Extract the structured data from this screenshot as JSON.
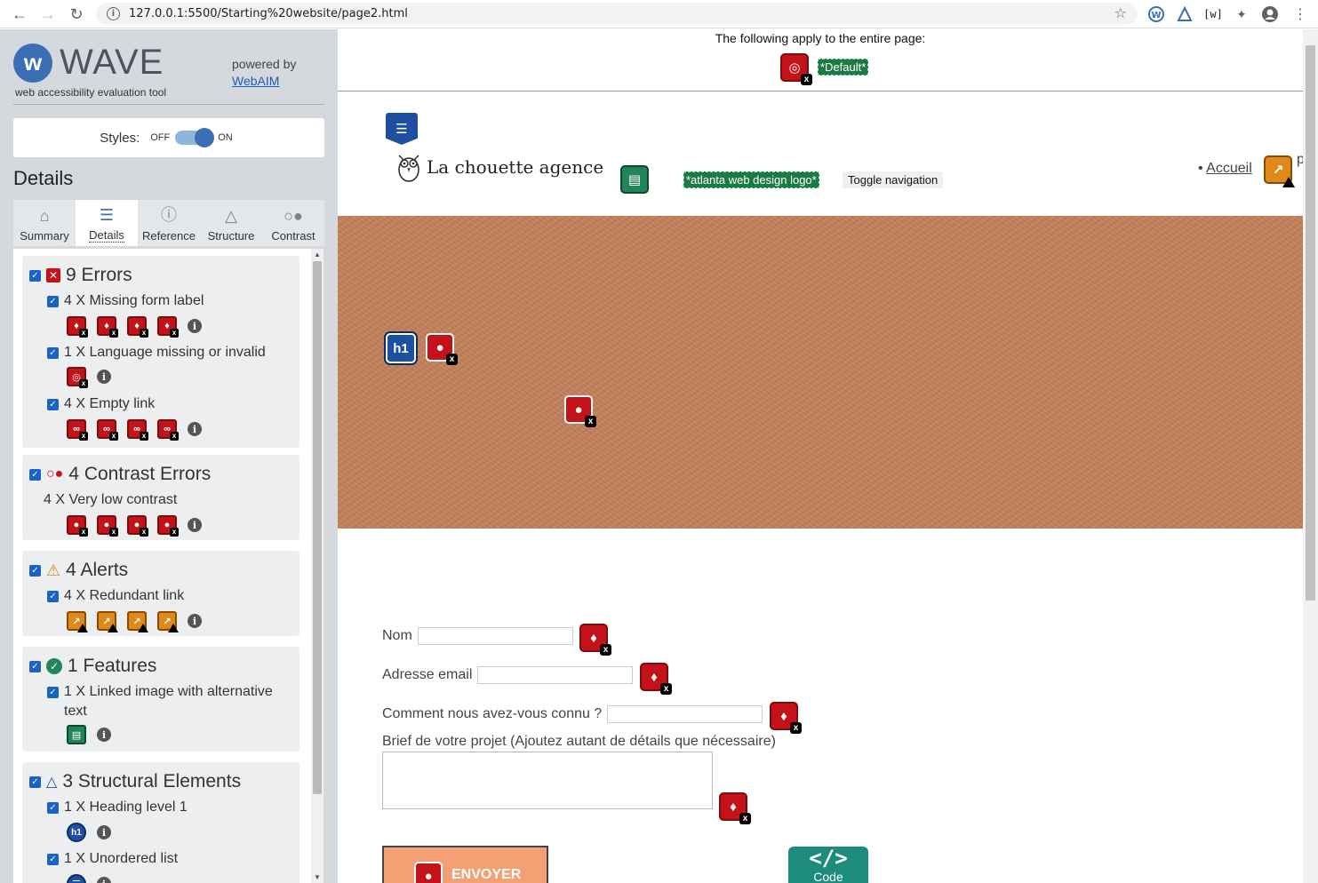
{
  "browser": {
    "url": "127.0.0.1:5500/Starting%20website/page2.html"
  },
  "wave": {
    "logo_text": "WAVE",
    "subtitle": "web accessibility evaluation tool",
    "powered_by": "powered by",
    "powered_link": "WebAIM",
    "styles_label": "Styles:",
    "styles_off": "OFF",
    "styles_on": "ON",
    "details_title": "Details",
    "tabs": [
      {
        "label": "Summary",
        "icon": "home-icon"
      },
      {
        "label": "Details",
        "icon": "list-icon"
      },
      {
        "label": "Reference",
        "icon": "info-icon"
      },
      {
        "label": "Structure",
        "icon": "structure-icon"
      },
      {
        "label": "Contrast",
        "icon": "contrast-icon"
      }
    ],
    "groups": {
      "errors": {
        "title": "9 Errors",
        "items": [
          {
            "label": "4 X Missing form label"
          },
          {
            "label": "1 X Language missing or invalid"
          },
          {
            "label": "4 X Empty link"
          }
        ]
      },
      "contrast": {
        "title": "4 Contrast Errors",
        "items": [
          {
            "label": "4 X Very low contrast"
          }
        ]
      },
      "alerts": {
        "title": "4 Alerts",
        "items": [
          {
            "label": "4 X Redundant link"
          }
        ]
      },
      "features": {
        "title": "1 Features",
        "items": [
          {
            "label": "1 X Linked image with alternative text"
          }
        ]
      },
      "structure": {
        "title": "3 Structural Elements",
        "items": [
          {
            "label": "1 X Heading level 1",
            "badge": "h1"
          },
          {
            "label": "1 X Unordered list"
          }
        ]
      }
    },
    "colors": {
      "error": "#c4121a",
      "alert": "#e0891b",
      "feature": "#22855a",
      "structure": "#1e4fa0",
      "checkbox": "#1a62c4"
    }
  },
  "page": {
    "applies_text": "The following apply to the entire page:",
    "default_label": "*Default*",
    "logo_alt_label": "*atlanta web design logo*",
    "toggle_nav": "Toggle navigation",
    "brand": "La chouette agence",
    "nav_link": "Accueil",
    "nav_cut": "p",
    "heading_badge": "h1",
    "form": {
      "nom": "Nom",
      "email": "Adresse email",
      "source": "Comment nous avez-vous connu ?",
      "brief": "Brief de votre projet (Ajoutez autant de détails que nécessaire)",
      "submit": "ENVOYER"
    },
    "code_badge": {
      "glyph": "</>",
      "label": "Code"
    }
  }
}
